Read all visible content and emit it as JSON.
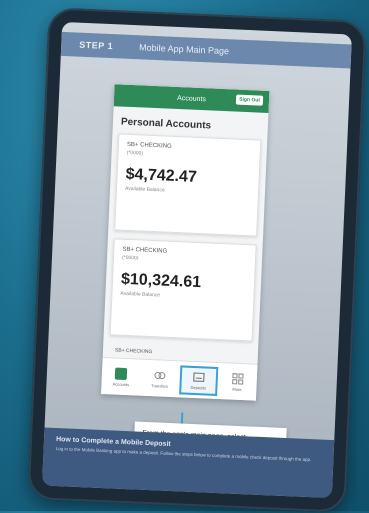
{
  "step_bar": {
    "step_label": "STEP 1",
    "page_label": "Mobile App Main Page"
  },
  "app": {
    "header_title": "Accounts",
    "sign_out": "Sign Out",
    "section_title": "Personal Accounts",
    "accounts": [
      {
        "name": "SB+ CHECKING",
        "number": "(*0000)",
        "balance": "$4,742.47",
        "balance_label": "Available Balance"
      },
      {
        "name": "SB+ CHECKING",
        "number": "(*0000)",
        "balance": "$10,324.61",
        "balance_label": "Available Balance"
      }
    ],
    "partial_account": "SB+ CHECKING",
    "nav": [
      {
        "label": "Accounts",
        "icon": "accounts-icon"
      },
      {
        "label": "Transfers",
        "icon": "transfer-icon"
      },
      {
        "label": "Deposits",
        "icon": "deposit-icon"
      },
      {
        "label": "More",
        "icon": "more-icon"
      }
    ]
  },
  "callout": {
    "text": "From the app's main page, select \"Deposits.\""
  },
  "footer": {
    "title": "How to Complete a Mobile Deposit",
    "description": "Log in to the Mobile Banking app to make a deposit. Follow the steps below to complete a mobile check deposit through the app."
  }
}
